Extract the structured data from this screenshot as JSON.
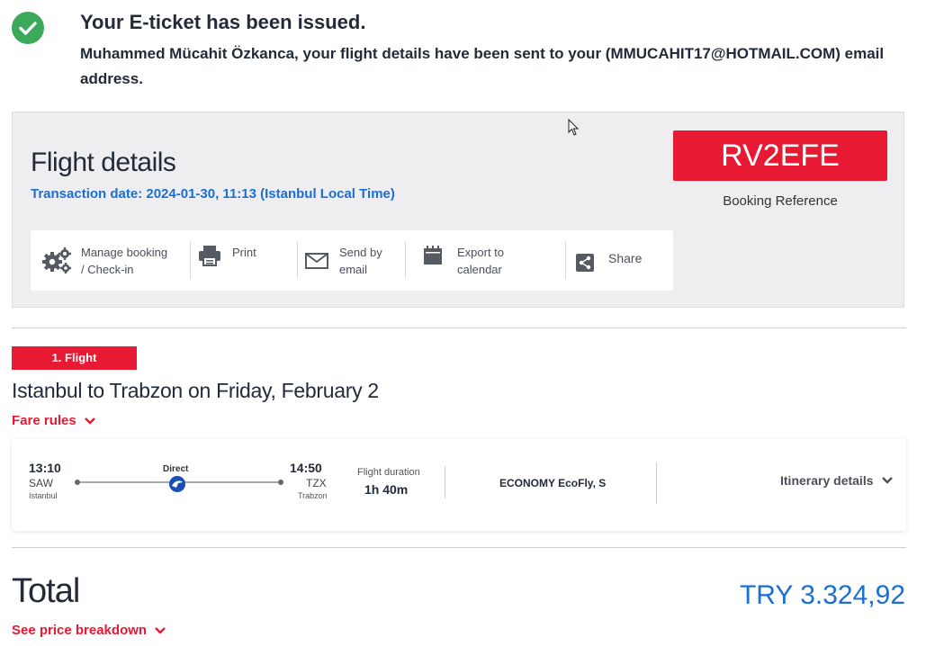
{
  "confirmation": {
    "title": "Your E-ticket has been issued.",
    "message": "Muhammed Mücahit Özkanca, your flight details have been sent to your (MMUCAHIT17@HOTMAIL.COM) email address."
  },
  "details": {
    "title": "Flight details",
    "transaction_date": "Transaction date: 2024-01-30, 11:13 (Istanbul Local Time)",
    "booking_reference": "RV2EFE",
    "booking_reference_label": "Booking Reference",
    "actions": [
      {
        "label_line1": "Manage booking",
        "label_line2": "/ Check-in",
        "icon": "gears-icon"
      },
      {
        "label_line1": "Print",
        "label_line2": "",
        "icon": "printer-icon"
      },
      {
        "label_line1": "Send by",
        "label_line2": "email",
        "icon": "envelope-icon"
      },
      {
        "label_line1": "Export to",
        "label_line2": "calendar",
        "icon": "calendar-icon"
      },
      {
        "label_line1": "Share",
        "label_line2": "",
        "icon": "share-icon"
      }
    ]
  },
  "flight": {
    "tag": "1. Flight",
    "route_title": "Istanbul to Trabzon on Friday, February 2",
    "fare_rules": "Fare rules",
    "departure": {
      "time": "13:10",
      "code": "SAW",
      "city": "Istanbul"
    },
    "arrival": {
      "time": "14:50",
      "code": "TZX",
      "city": "Trabzon"
    },
    "stop_type": "Direct",
    "duration_label": "Flight duration",
    "duration": "1h 40m",
    "cabin": "ECONOMY EcoFly, S",
    "itinerary_link": "Itinerary details"
  },
  "total": {
    "label": "Total",
    "amount": "TRY 3.324,92",
    "breakdown_link": "See price breakdown"
  },
  "colors": {
    "brand_red": "#e81932",
    "link_blue": "#1a6fd6",
    "success_green": "#3aaa5a"
  }
}
